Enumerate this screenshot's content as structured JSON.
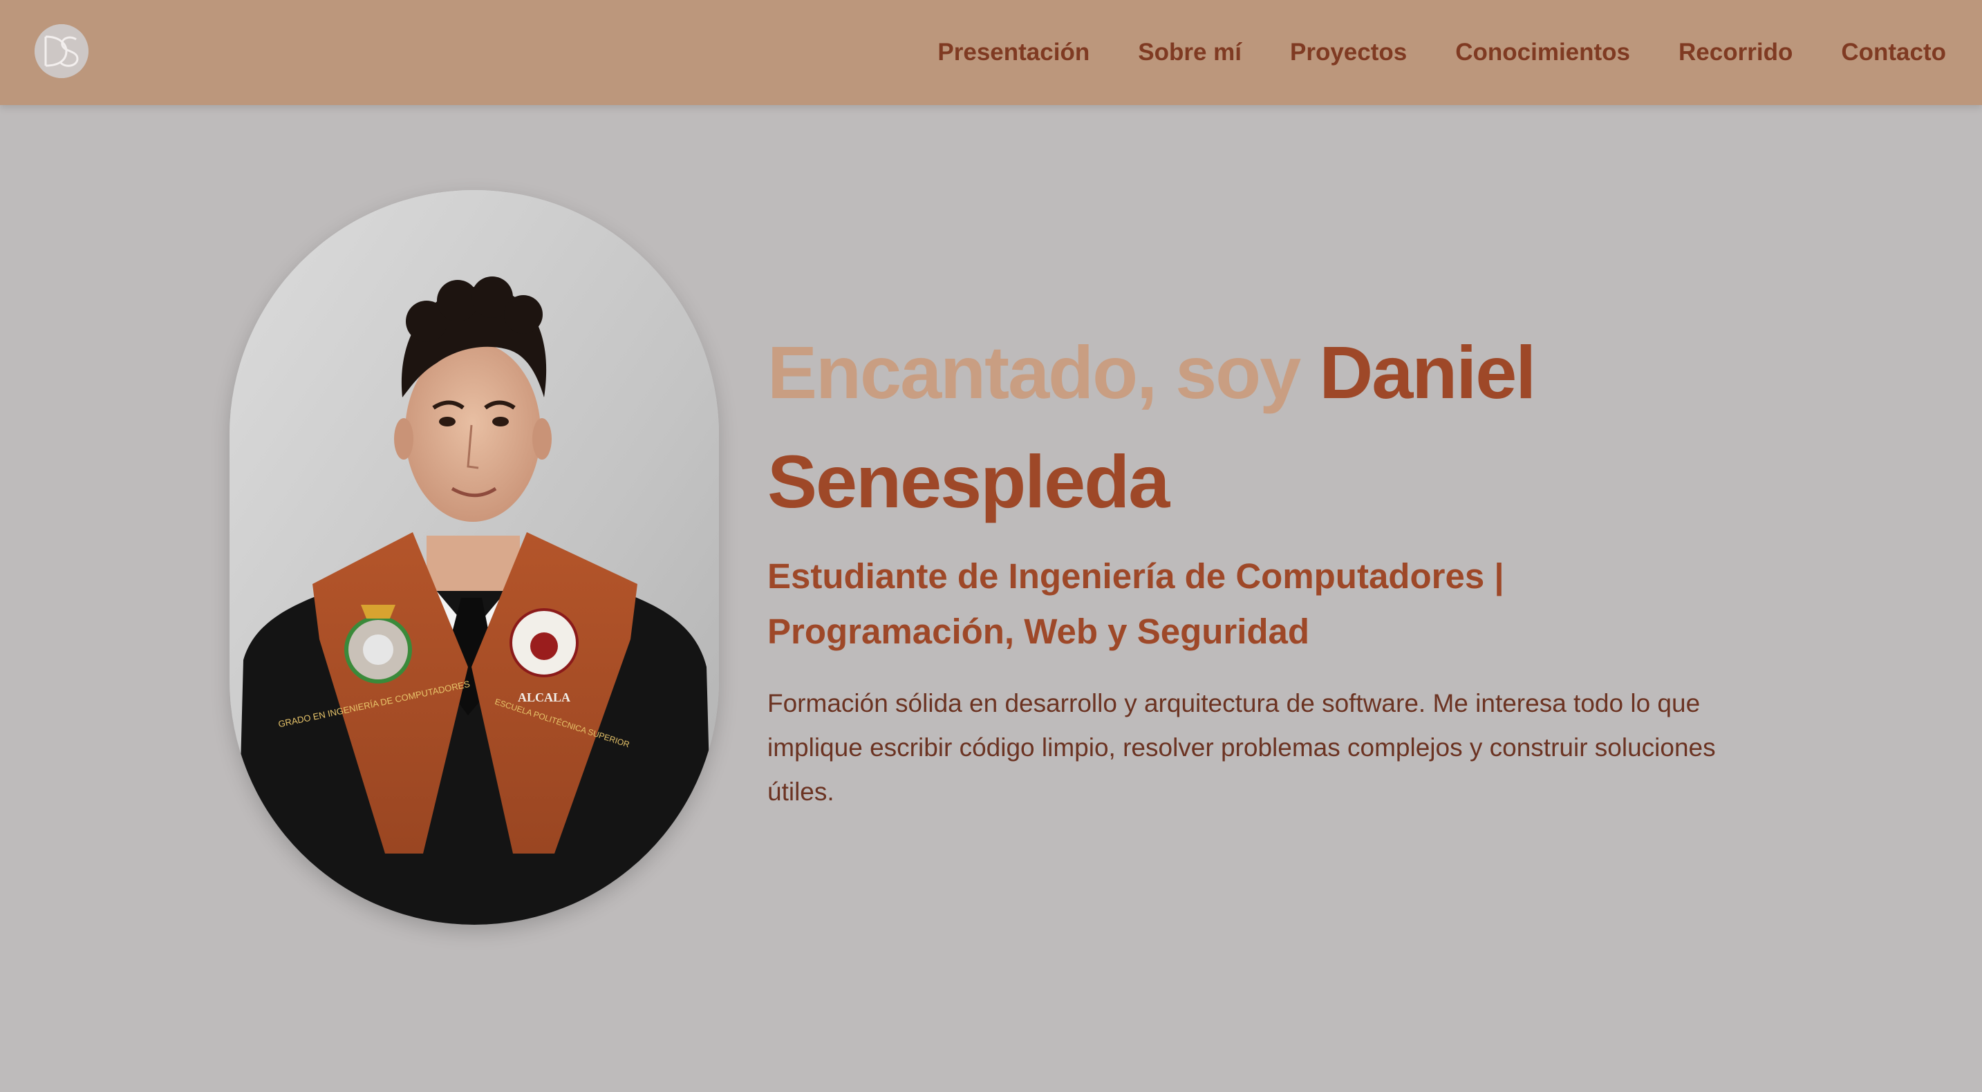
{
  "nav": {
    "logo_text": "DS",
    "links": [
      {
        "label": "Presentación"
      },
      {
        "label": "Sobre mí"
      },
      {
        "label": "Proyectos"
      },
      {
        "label": "Conocimientos"
      },
      {
        "label": "Recorrido"
      },
      {
        "label": "Contacto"
      }
    ]
  },
  "hero": {
    "greeting": "Encantado, soy ",
    "name": "Daniel Senespleda",
    "subtitle": "Estudiante de Ingeniería de Computadores | Programación, Web y Seguridad",
    "description": "Formación sólida en desarrollo y arquitectura de software. Me interesa todo lo que implique escribir código limpio, resolver problemas complejos y construir soluciones útiles.",
    "photo_stole_text_left": "GRADO EN INGENIERÍA DE COMPUTADORES",
    "photo_stole_text_right": "ESCUELA POLITÉCNICA SUPERIOR",
    "photo_crest_text": "ALCALA"
  },
  "colors": {
    "nav_bg": "#bc977c",
    "page_bg": "#bebbbb",
    "accent_dark": "#9e4828",
    "accent_light": "#c99e82",
    "text_body": "#6b3322"
  }
}
